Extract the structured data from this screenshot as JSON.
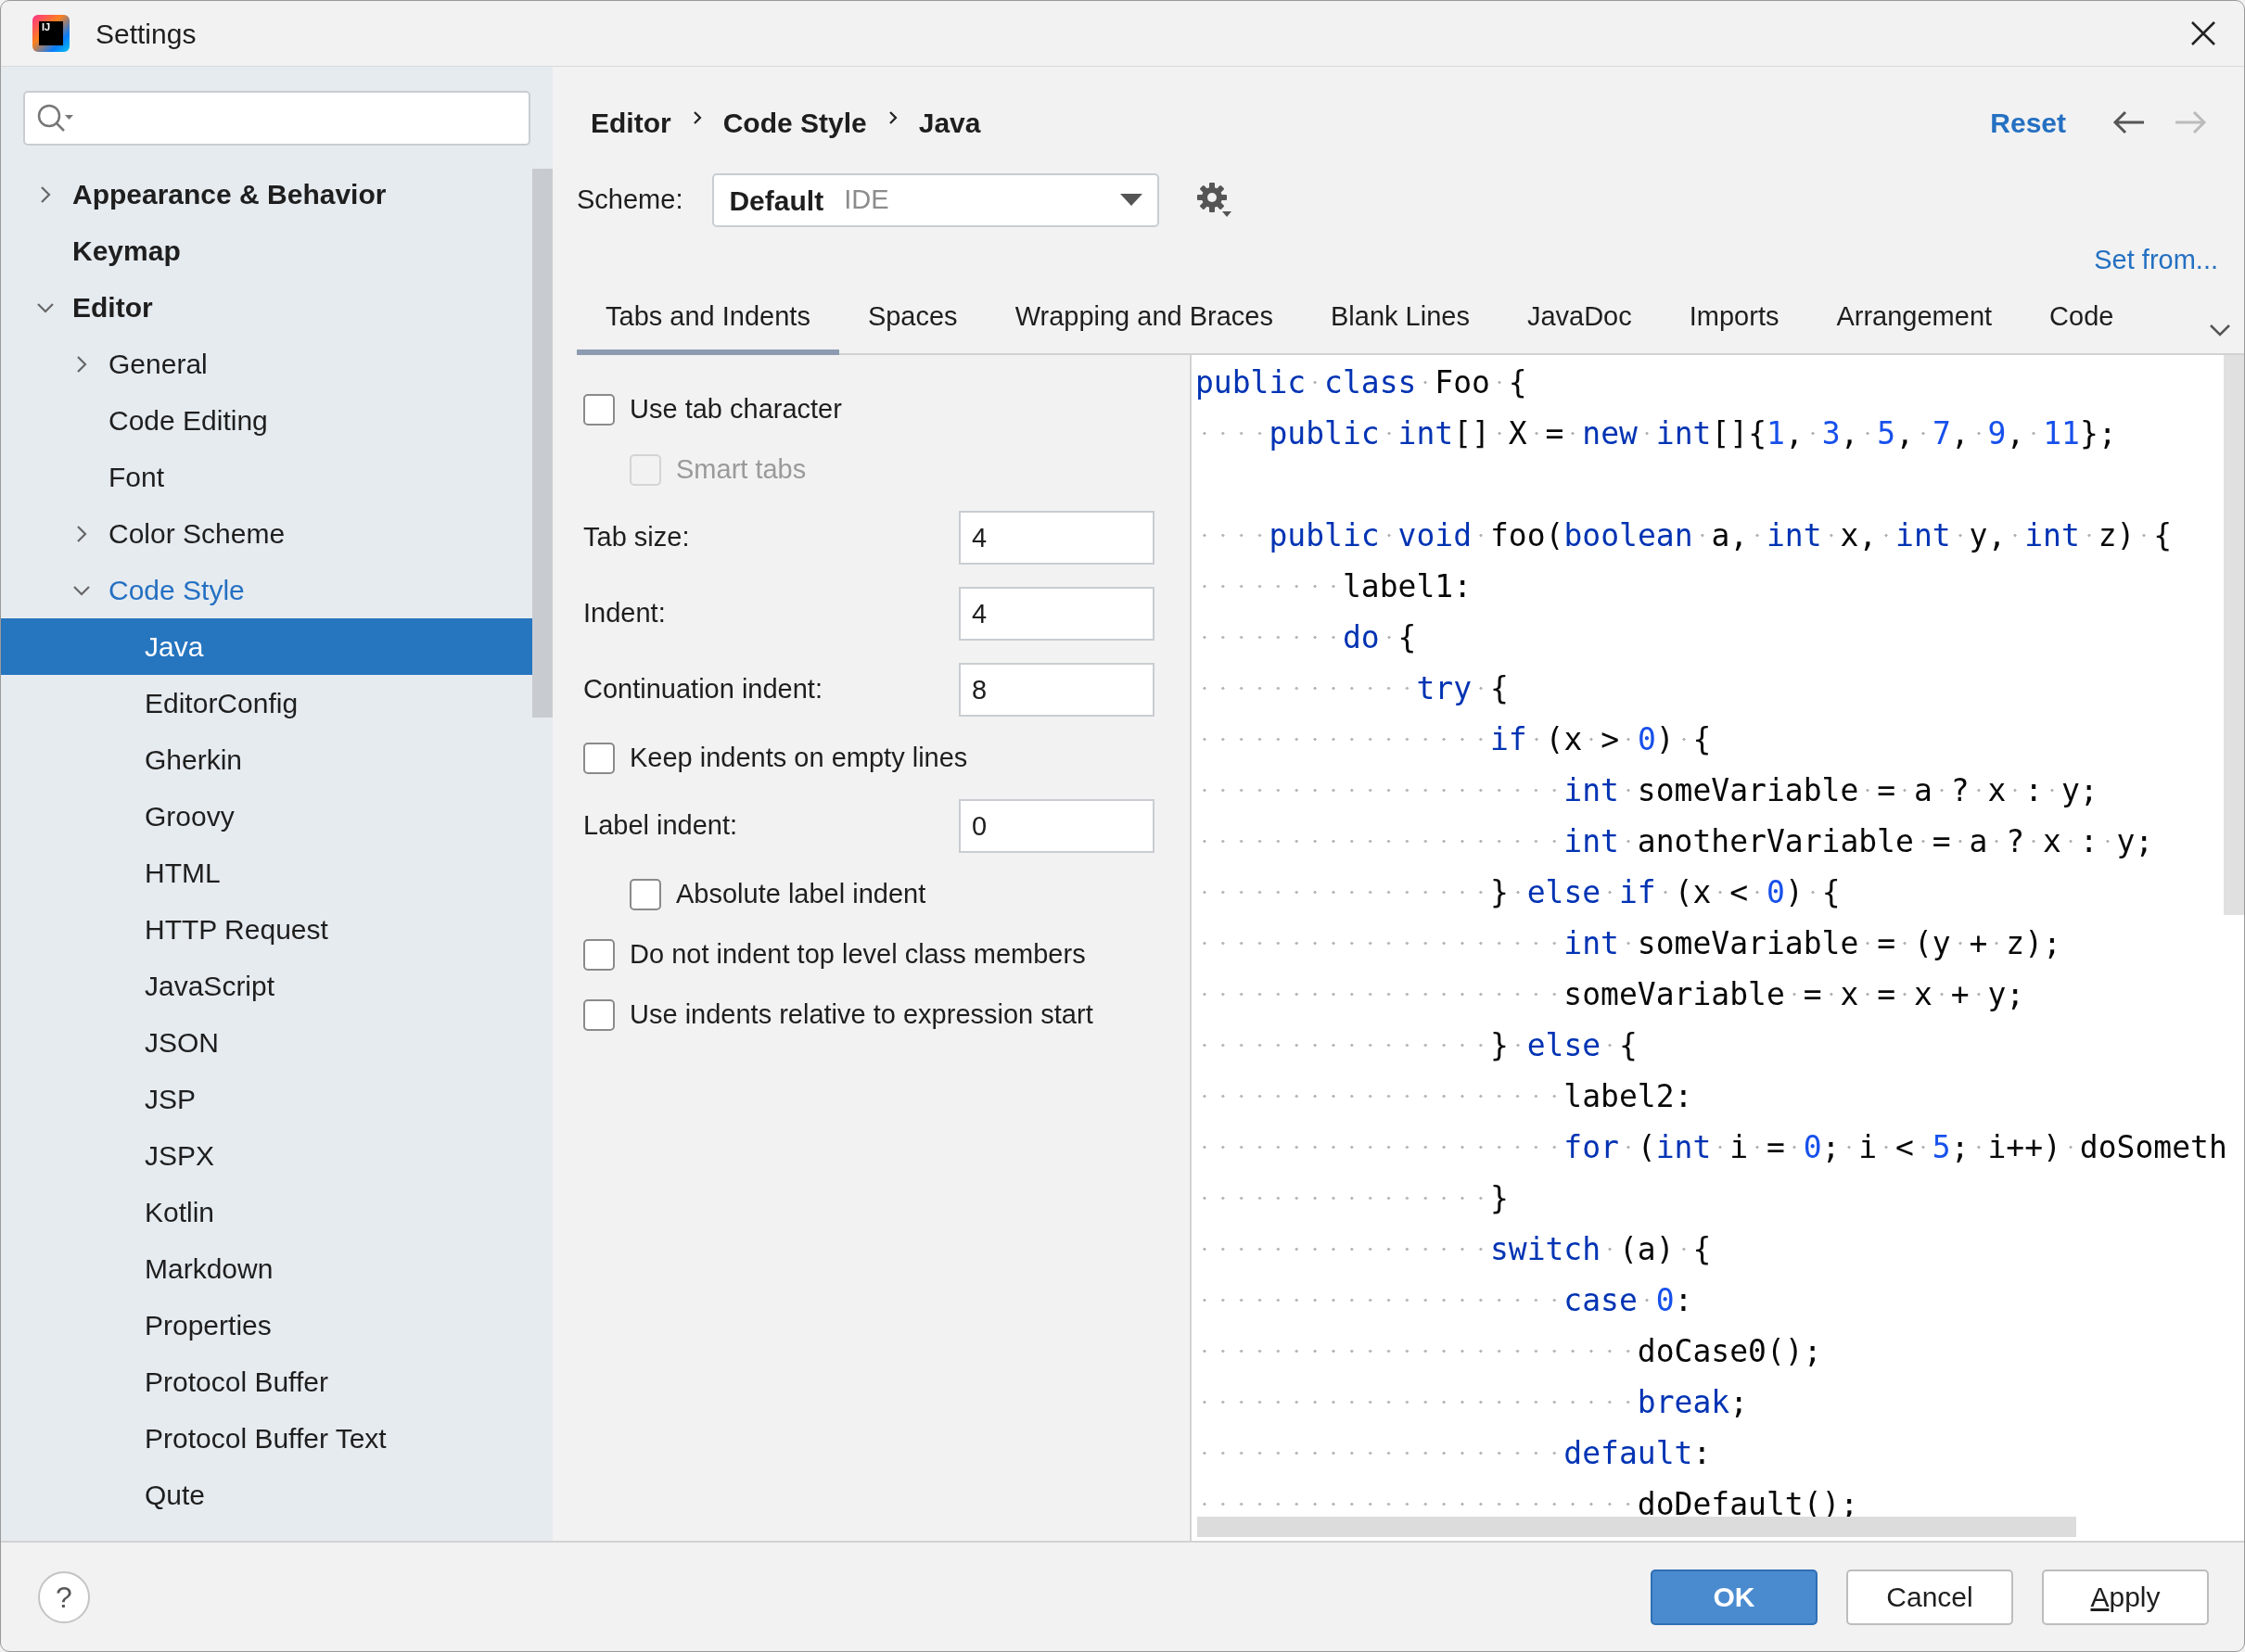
{
  "window": {
    "title": "Settings",
    "icon_label": "IJ"
  },
  "sidebar": {
    "items": [
      {
        "label": "Appearance & Behavior",
        "expanded": false,
        "selected": false,
        "highlighted": false
      },
      {
        "label": "Keymap",
        "selected": false,
        "highlighted": false
      },
      {
        "label": "Editor",
        "expanded": true,
        "selected": false,
        "highlighted": false,
        "children": [
          {
            "label": "General",
            "expanded": false,
            "selected": false,
            "highlighted": false
          },
          {
            "label": "Code Editing",
            "selected": false,
            "highlighted": false
          },
          {
            "label": "Font",
            "selected": false,
            "highlighted": false
          },
          {
            "label": "Color Scheme",
            "expanded": false,
            "selected": false,
            "highlighted": false
          },
          {
            "label": "Code Style",
            "expanded": true,
            "selected": false,
            "highlighted": true,
            "children": [
              {
                "label": "Java",
                "selected": true,
                "highlighted": false
              },
              {
                "label": "EditorConfig",
                "selected": false,
                "highlighted": false
              },
              {
                "label": "Gherkin",
                "selected": false,
                "highlighted": false
              },
              {
                "label": "Groovy",
                "selected": false,
                "highlighted": false
              },
              {
                "label": "HTML",
                "selected": false,
                "highlighted": false
              },
              {
                "label": "HTTP Request",
                "selected": false,
                "highlighted": false
              },
              {
                "label": "JavaScript",
                "selected": false,
                "highlighted": false
              },
              {
                "label": "JSON",
                "selected": false,
                "highlighted": false
              },
              {
                "label": "JSP",
                "selected": false,
                "highlighted": false
              },
              {
                "label": "JSPX",
                "selected": false,
                "highlighted": false
              },
              {
                "label": "Kotlin",
                "selected": false,
                "highlighted": false
              },
              {
                "label": "Markdown",
                "selected": false,
                "highlighted": false
              },
              {
                "label": "Properties",
                "selected": false,
                "highlighted": false
              },
              {
                "label": "Protocol Buffer",
                "selected": false,
                "highlighted": false
              },
              {
                "label": "Protocol Buffer Text",
                "selected": false,
                "highlighted": false
              },
              {
                "label": "Qute",
                "selected": false,
                "highlighted": false
              }
            ]
          }
        ]
      }
    ]
  },
  "breadcrumb": [
    "Editor",
    "Code Style",
    "Java"
  ],
  "header_actions": {
    "reset": "Reset",
    "back_disabled": false,
    "forward_disabled": true
  },
  "scheme": {
    "label": "Scheme:",
    "name": "Default",
    "type": "IDE"
  },
  "set_from": "Set from...",
  "tabs": [
    {
      "label": "Tabs and Indents",
      "selected": true
    },
    {
      "label": "Spaces",
      "selected": false
    },
    {
      "label": "Wrapping and Braces",
      "selected": false
    },
    {
      "label": "Blank Lines",
      "selected": false
    },
    {
      "label": "JavaDoc",
      "selected": false
    },
    {
      "label": "Imports",
      "selected": false
    },
    {
      "label": "Arrangement",
      "selected": false
    },
    {
      "label": "Code",
      "selected": false
    }
  ],
  "options": [
    {
      "kind": "checkbox",
      "label": "Use tab character",
      "checked": false,
      "disabled": false,
      "children": [
        {
          "kind": "checkbox",
          "label": "Smart tabs",
          "checked": false,
          "disabled": true
        }
      ]
    },
    {
      "kind": "number",
      "label": "Tab size:",
      "value": "4"
    },
    {
      "kind": "number",
      "label": "Indent:",
      "value": "4"
    },
    {
      "kind": "number",
      "label": "Continuation indent:",
      "value": "8"
    },
    {
      "kind": "checkbox",
      "label": "Keep indents on empty lines",
      "checked": false,
      "disabled": false
    },
    {
      "kind": "number",
      "label": "Label indent:",
      "value": "0",
      "children": [
        {
          "kind": "checkbox",
          "label": "Absolute label indent",
          "checked": false,
          "disabled": false
        }
      ]
    },
    {
      "kind": "checkbox",
      "label": "Do not indent top level class members",
      "checked": false,
      "disabled": false
    },
    {
      "kind": "checkbox",
      "label": "Use indents relative to expression start",
      "checked": false,
      "disabled": false
    }
  ],
  "code": [
    {
      "kind": "code",
      "tokens": [
        {
          "kind": "keyword",
          "text": "public class"
        },
        {
          "kind": "plain",
          "text": " Foo {"
        }
      ]
    },
    {
      "kind": "code",
      "tokens": [
        {
          "kind": "keyword",
          "text": "    public int"
        },
        {
          "kind": "plain",
          "text": "[] X = "
        },
        {
          "kind": "keyword",
          "text": "new int"
        },
        {
          "kind": "plain",
          "text": "[]{"
        },
        {
          "kind": "number",
          "text": "1"
        },
        {
          "kind": "plain",
          "text": ", "
        },
        {
          "kind": "number",
          "text": "3"
        },
        {
          "kind": "plain",
          "text": ", "
        },
        {
          "kind": "number",
          "text": "5"
        },
        {
          "kind": "plain",
          "text": ", "
        },
        {
          "kind": "number",
          "text": "7"
        },
        {
          "kind": "plain",
          "text": ", "
        },
        {
          "kind": "number",
          "text": "9"
        },
        {
          "kind": "plain",
          "text": ", "
        },
        {
          "kind": "number",
          "text": "11"
        },
        {
          "kind": "plain",
          "text": "};"
        }
      ]
    },
    {
      "kind": "blank"
    },
    {
      "kind": "code",
      "tokens": [
        {
          "kind": "keyword",
          "text": "    public void"
        },
        {
          "kind": "plain",
          "text": " foo("
        },
        {
          "kind": "keyword",
          "text": "boolean"
        },
        {
          "kind": "plain",
          "text": " a, "
        },
        {
          "kind": "keyword",
          "text": "int"
        },
        {
          "kind": "plain",
          "text": " x, "
        },
        {
          "kind": "keyword",
          "text": "int"
        },
        {
          "kind": "plain",
          "text": " y, "
        },
        {
          "kind": "keyword",
          "text": "int"
        },
        {
          "kind": "plain",
          "text": " z) {"
        }
      ]
    },
    {
      "kind": "code",
      "tokens": [
        {
          "kind": "plain",
          "text": "        label1:"
        }
      ]
    },
    {
      "kind": "code",
      "tokens": [
        {
          "kind": "keyword",
          "text": "        do"
        },
        {
          "kind": "plain",
          "text": " {"
        }
      ]
    },
    {
      "kind": "code",
      "tokens": [
        {
          "kind": "keyword",
          "text": "            try"
        },
        {
          "kind": "plain",
          "text": " {"
        }
      ]
    },
    {
      "kind": "code",
      "tokens": [
        {
          "kind": "keyword",
          "text": "                if"
        },
        {
          "kind": "plain",
          "text": " (x > "
        },
        {
          "kind": "number",
          "text": "0"
        },
        {
          "kind": "plain",
          "text": ") {"
        }
      ]
    },
    {
      "kind": "code",
      "tokens": [
        {
          "kind": "keyword",
          "text": "                    int"
        },
        {
          "kind": "plain",
          "text": " someVariable = a ? x : y;"
        }
      ]
    },
    {
      "kind": "code",
      "tokens": [
        {
          "kind": "keyword",
          "text": "                    int"
        },
        {
          "kind": "plain",
          "text": " anotherVariable = a ? x : y;"
        }
      ]
    },
    {
      "kind": "code",
      "tokens": [
        {
          "kind": "plain",
          "text": "                } "
        },
        {
          "kind": "keyword",
          "text": "else if"
        },
        {
          "kind": "plain",
          "text": " (x < "
        },
        {
          "kind": "number",
          "text": "0"
        },
        {
          "kind": "plain",
          "text": ") {"
        }
      ]
    },
    {
      "kind": "code",
      "tokens": [
        {
          "kind": "keyword",
          "text": "                    int"
        },
        {
          "kind": "plain",
          "text": " someVariable = (y + z);"
        }
      ]
    },
    {
      "kind": "code",
      "tokens": [
        {
          "kind": "plain",
          "text": "                    someVariable = x = x + y;"
        }
      ]
    },
    {
      "kind": "code",
      "tokens": [
        {
          "kind": "plain",
          "text": "                } "
        },
        {
          "kind": "keyword",
          "text": "else"
        },
        {
          "kind": "plain",
          "text": " {"
        }
      ]
    },
    {
      "kind": "code",
      "tokens": [
        {
          "kind": "plain",
          "text": "                    label2:"
        }
      ]
    },
    {
      "kind": "code",
      "tokens": [
        {
          "kind": "keyword",
          "text": "                    for"
        },
        {
          "kind": "plain",
          "text": " ("
        },
        {
          "kind": "keyword",
          "text": "int"
        },
        {
          "kind": "plain",
          "text": " i = "
        },
        {
          "kind": "number",
          "text": "0"
        },
        {
          "kind": "plain",
          "text": "; i < "
        },
        {
          "kind": "number",
          "text": "5"
        },
        {
          "kind": "plain",
          "text": "; i++) doSometh"
        }
      ]
    },
    {
      "kind": "code",
      "tokens": [
        {
          "kind": "plain",
          "text": "                }"
        }
      ]
    },
    {
      "kind": "code",
      "tokens": [
        {
          "kind": "keyword",
          "text": "                switch"
        },
        {
          "kind": "plain",
          "text": " (a) {"
        }
      ]
    },
    {
      "kind": "code",
      "tokens": [
        {
          "kind": "keyword",
          "text": "                    case"
        },
        {
          "kind": "number",
          "text": " 0"
        },
        {
          "kind": "plain",
          "text": ":"
        }
      ]
    },
    {
      "kind": "code",
      "tokens": [
        {
          "kind": "plain",
          "text": "                        doCase0();"
        }
      ]
    },
    {
      "kind": "code",
      "tokens": [
        {
          "kind": "keyword",
          "text": "                        break"
        },
        {
          "kind": "plain",
          "text": ";"
        }
      ]
    },
    {
      "kind": "code",
      "tokens": [
        {
          "kind": "keyword",
          "text": "                    default"
        },
        {
          "kind": "plain",
          "text": ":"
        }
      ]
    },
    {
      "kind": "code",
      "tokens": [
        {
          "kind": "plain",
          "text": "                        doDefault();"
        }
      ]
    }
  ],
  "footer": {
    "help_label": "?",
    "buttons": [
      {
        "label": "OK",
        "kind": "primary",
        "mnemonic": false
      },
      {
        "label": "Cancel",
        "kind": "normal",
        "mnemonic": false
      },
      {
        "label": "Apply",
        "kind": "normal",
        "mnemonic": true
      }
    ]
  }
}
